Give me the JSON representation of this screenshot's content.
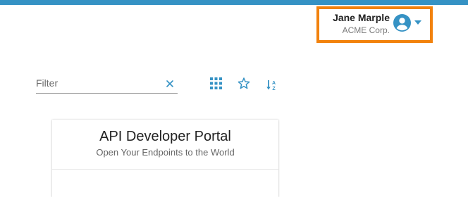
{
  "header": {
    "user_name": "Jane Marple",
    "organization": "ACME Corp."
  },
  "filter": {
    "label": "Filter"
  },
  "toolbar": {
    "icons": [
      "grid-view-icon",
      "favorites-star-icon",
      "sort-icon"
    ],
    "sort_glyph": "A Z"
  },
  "cards": [
    {
      "title": "API Developer Portal",
      "subtitle": "Open Your Endpoints to the World"
    }
  ],
  "colors": {
    "accent": "#3592c4",
    "highlight_border": "#f2820d"
  }
}
